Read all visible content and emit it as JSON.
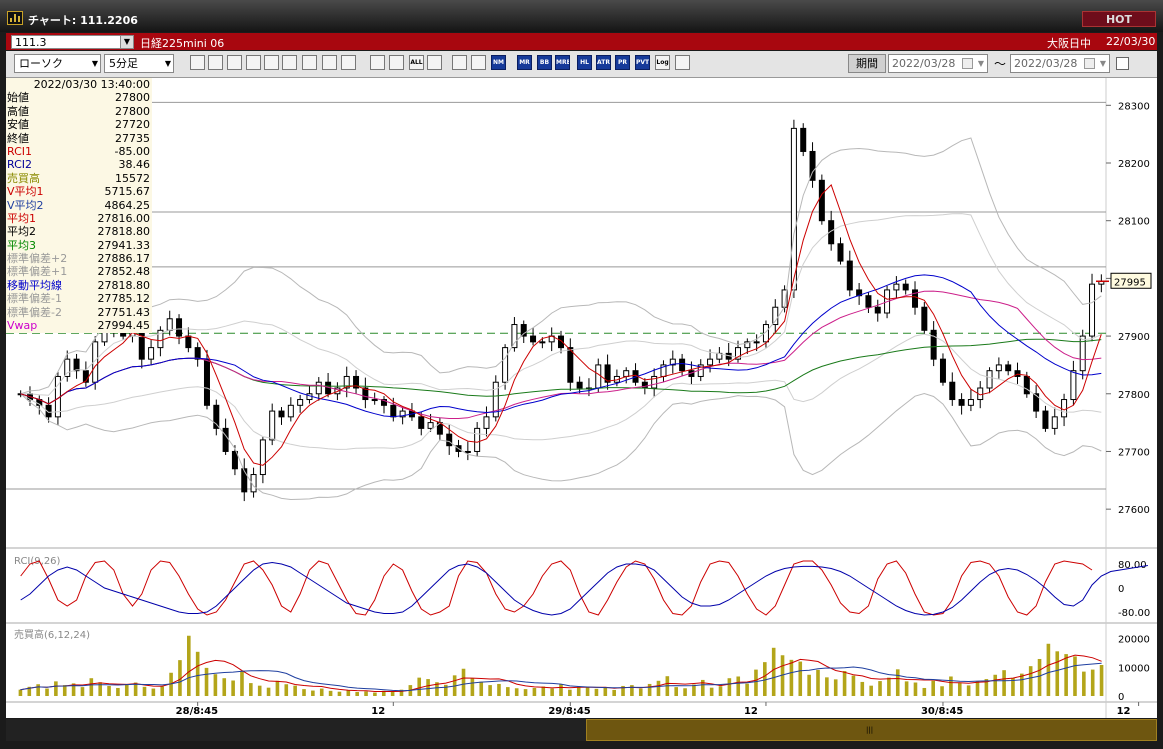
{
  "window": {
    "title": "チャート: 111.2206",
    "hot_label": "HOT"
  },
  "symbol_bar": {
    "symbol": "111.3",
    "instrument": "日経225mini 06",
    "session": "大阪日中",
    "date": "22/03/30"
  },
  "toolbar": {
    "chart_type": "ローソク",
    "interval": "5分足",
    "buttons": [
      "zoom",
      "cursor",
      "trend-line",
      "draw",
      "compare",
      "marker",
      "pen",
      "select",
      "undo",
      "candle",
      "bar-type",
      "all",
      "paint",
      "tools",
      "color",
      "nm",
      "mr",
      "bb",
      "mre",
      "hl",
      "atr",
      "prra",
      "pvt",
      "log",
      "export"
    ],
    "button_labels": {
      "all": "ALL",
      "nm": "NM",
      "mr": "MR",
      "bb": "BB",
      "mre": "MRE",
      "hl": "HL",
      "atr": "ATR",
      "prra": "PR RA",
      "pvt": "PVT",
      "log": "Log"
    },
    "period_label": "期間",
    "date_from": "2022/03/28",
    "date_tilde": "〜",
    "date_to": "2022/03/28"
  },
  "info_panel": {
    "timestamp": "2022/03/30  13:40:00",
    "rows": [
      {
        "label": "始値",
        "value": "27800",
        "color": "#000000"
      },
      {
        "label": "高値",
        "value": "27800",
        "color": "#000000"
      },
      {
        "label": "安値",
        "value": "27720",
        "color": "#000000"
      },
      {
        "label": "終値",
        "value": "27735",
        "color": "#000000"
      },
      {
        "label": "RCI1",
        "value": "-85.00",
        "color": "#cc0000"
      },
      {
        "label": "RCI2",
        "value": "38.46",
        "color": "#000099"
      },
      {
        "label": "売買高",
        "value": "15572",
        "color": "#8a8a00"
      },
      {
        "label": "V平均1",
        "value": "5715.67",
        "color": "#cc0000"
      },
      {
        "label": "V平均2",
        "value": "4864.25",
        "color": "#1f3fa0"
      },
      {
        "label": "平均1",
        "value": "27816.00",
        "color": "#cc0000"
      },
      {
        "label": "平均2",
        "value": "27818.80",
        "color": "#000000"
      },
      {
        "label": "平均3",
        "value": "27941.33",
        "color": "#008800"
      },
      {
        "label": "標準偏差+2",
        "value": "27886.17",
        "color": "#999999"
      },
      {
        "label": "標準偏差+1",
        "value": "27852.48",
        "color": "#999999"
      },
      {
        "label": "移動平均線",
        "value": "27818.80",
        "color": "#0000cc"
      },
      {
        "label": "標準偏差-1",
        "value": "27785.12",
        "color": "#999999"
      },
      {
        "label": "標準偏差-2",
        "value": "27751.43",
        "color": "#999999"
      },
      {
        "label": "Vwap",
        "value": "27994.45",
        "color": "#cc00cc"
      }
    ]
  },
  "chart_data": [
    {
      "type": "candlestick",
      "ylim": [
        27550,
        28330
      ],
      "yticks": [
        27600,
        27700,
        27800,
        27900,
        28000,
        28100,
        28200,
        28300
      ],
      "xticks": [
        {
          "index": 19,
          "label": "28/8:45"
        },
        {
          "index": 40,
          "label": "12"
        },
        {
          "index": 59,
          "label": "29/8:45"
        },
        {
          "index": 80,
          "label": "12"
        },
        {
          "index": 99,
          "label": "30/8:45"
        },
        {
          "index": 120,
          "label": "12"
        }
      ],
      "current_price_label": "27995",
      "current_price": 27995,
      "dashed_level": 27905,
      "horizontal_levels": [
        28305,
        28115,
        28020,
        27635
      ],
      "close": [
        27800,
        27790,
        27780,
        27760,
        27830,
        27860,
        27840,
        27820,
        27890,
        27910,
        27920,
        27900,
        27910,
        27860,
        27880,
        27910,
        27930,
        27900,
        27880,
        27860,
        27780,
        27740,
        27700,
        27670,
        27630,
        27660,
        27720,
        27770,
        27760,
        27780,
        27790,
        27800,
        27820,
        27800,
        27810,
        27830,
        27810,
        27790,
        27790,
        27780,
        27760,
        27770,
        27760,
        27740,
        27750,
        27730,
        27710,
        27700,
        27700,
        27740,
        27760,
        27820,
        27880,
        27920,
        27900,
        27890,
        27890,
        27900,
        27880,
        27820,
        27810,
        27810,
        27850,
        27820,
        27830,
        27840,
        27820,
        27810,
        27830,
        27850,
        27860,
        27840,
        27830,
        27850,
        27860,
        27870,
        27860,
        27880,
        27890,
        27890,
        27920,
        27950,
        27980,
        28260,
        28220,
        28170,
        28100,
        28060,
        28030,
        27980,
        27970,
        27950,
        27940,
        27980,
        27990,
        27980,
        27950,
        27910,
        27860,
        27820,
        27790,
        27780,
        27790,
        27810,
        27840,
        27850,
        27840,
        27830,
        27800,
        27770,
        27740,
        27760,
        27790,
        27840,
        27900,
        27990,
        27995
      ]
    },
    {
      "type": "line",
      "title": "RCI(9,26)",
      "ylim": [
        -100,
        100
      ],
      "yticks": [
        80,
        0,
        -80
      ],
      "ytick_labels": [
        "80.00",
        "0",
        "-80.00"
      ],
      "series": [
        {
          "color": "#cc0000",
          "values": [
            40,
            80,
            90,
            30,
            -40,
            -60,
            -40,
            40,
            85,
            90,
            60,
            -20,
            -60,
            -20,
            60,
            90,
            85,
            40,
            -20,
            -70,
            -90,
            -80,
            -40,
            20,
            80,
            90,
            60,
            10,
            -60,
            -80,
            -20,
            60,
            90,
            80,
            20,
            -40,
            -85,
            -90,
            -40,
            40,
            80,
            60,
            -10,
            -70,
            -90,
            -80,
            -60,
            40,
            90,
            85,
            50,
            -20,
            -70,
            -80,
            -60,
            -20,
            40,
            80,
            90,
            60,
            -20,
            -80,
            -90,
            -40,
            20,
            70,
            90,
            80,
            30,
            -40,
            -85,
            -90,
            -60,
            20,
            80,
            90,
            85,
            40,
            -20,
            -70,
            -90,
            -60,
            10,
            80,
            90,
            90,
            60,
            10,
            -50,
            -80,
            -85,
            -60,
            30,
            80,
            90,
            50,
            -20,
            -80,
            -90,
            -85,
            -40,
            40,
            85,
            90,
            80,
            40,
            -30,
            -80,
            -90,
            -60,
            20,
            80,
            90,
            85,
            80,
            60
          ]
        },
        {
          "color": "#0000aa",
          "values": [
            -40,
            -20,
            10,
            40,
            60,
            70,
            60,
            40,
            20,
            0,
            -10,
            -20,
            -30,
            -40,
            -50,
            -60,
            -70,
            -80,
            -85,
            -85,
            -80,
            -60,
            -30,
            0,
            30,
            60,
            80,
            85,
            80,
            70,
            50,
            30,
            10,
            -10,
            -30,
            -50,
            -60,
            -70,
            -80,
            -85,
            -85,
            -80,
            -60,
            -30,
            0,
            30,
            60,
            75,
            80,
            70,
            50,
            20,
            -10,
            -40,
            -60,
            -75,
            -85,
            -90,
            -85,
            -70,
            -40,
            -10,
            20,
            50,
            70,
            80,
            80,
            75,
            60,
            30,
            0,
            -30,
            -50,
            -60,
            -60,
            -55,
            -40,
            -20,
            0,
            20,
            40,
            55,
            65,
            70,
            72,
            72,
            70,
            65,
            55,
            40,
            20,
            0,
            -20,
            -40,
            -60,
            -75,
            -85,
            -90,
            -88,
            -80,
            -65,
            -40,
            -10,
            20,
            45,
            60,
            65,
            60,
            45,
            25,
            0,
            -30,
            -55,
            -60,
            -40,
            10,
            40,
            55,
            60,
            65,
            70,
            75
          ]
        }
      ]
    },
    {
      "type": "bar",
      "title": "売買高(6,12,24)",
      "ylim": [
        0,
        23000
      ],
      "yticks": [
        0,
        10000,
        20000
      ],
      "ytick_labels": [
        "0",
        "10000",
        "20000"
      ],
      "values": [
        2200,
        3200,
        4100,
        2600,
        5100,
        3800,
        4400,
        3100,
        6200,
        4800,
        3500,
        2800,
        3900,
        4700,
        3200,
        2600,
        3300,
        8100,
        12500,
        21000,
        15400,
        9800,
        7600,
        6200,
        5400,
        8800,
        4500,
        3600,
        2900,
        5300,
        4100,
        3600,
        2400,
        1900,
        2600,
        1800,
        1500,
        2000,
        1400,
        1600,
        1200,
        1800,
        1500,
        2200,
        3800,
        6400,
        5900,
        4800,
        3900,
        7200,
        9500,
        6100,
        5000,
        3800,
        4200,
        3100,
        2700,
        2400,
        2800,
        3300,
        2600,
        4100,
        2200,
        3400,
        3100,
        2500,
        2900,
        2100,
        3500,
        3800,
        2600,
        4200,
        5300,
        6900,
        3100,
        2700,
        4000,
        5600,
        2900,
        3400,
        6200,
        6800,
        4300,
        9200,
        11800,
        16800,
        14200,
        12600,
        12000,
        7400,
        9100,
        6500,
        5800,
        8700,
        7100,
        4900,
        3600,
        5200,
        6400,
        9300,
        5100,
        4700,
        2800,
        5300,
        3400,
        6800,
        4500,
        3700,
        5200,
        5900,
        7400,
        9000,
        6300,
        7800,
        10400,
        12900,
        18200,
        15572,
        14600,
        13800,
        8500,
        9200,
        10800
      ]
    }
  ]
}
